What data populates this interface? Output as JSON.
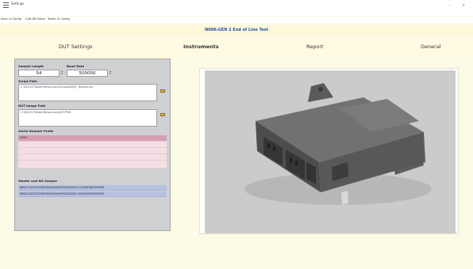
{
  "window": {
    "title": "Settings",
    "minimize_glyph": "–",
    "close_glyph": "×"
  },
  "menu": {
    "items": [
      "Save",
      "UI Config",
      "CAN DB Editor",
      "Tester IO Config"
    ]
  },
  "header": {
    "title": "N90K-GEN 2 End of Line Test"
  },
  "tabs": [
    "DUT Settings",
    "Instruments",
    "Report",
    "General"
  ],
  "dut_settings": {
    "sample_length_label": "Sample Length",
    "sample_length_value": "54",
    "baud_rate_label": "Baud Rate",
    "baud_rate_value": "500000",
    "script_path_label": "Script Path",
    "script_path_value": "C:\\DUI-EY-Tester\\Resources\\Scripts\\N90K_Testing.csv",
    "image_path_label": "DUT Image Path",
    "image_path_value": "C:\\DUI-EY-Tester\\Resources\\DUT.PNG",
    "serial_prefix_label": "Serial Number Prefix",
    "serial_prefix_values": [
      "N90K",
      "",
      "",
      "",
      ""
    ],
    "master_samples_label": "Master and NG Sample",
    "master_samples": [
      "N90K-21000123456784A3A9A9AF0203A0012-1234567892094389",
      "N90K-21000123456784A3A9A9AF0203A0012-9000000000000000"
    ]
  },
  "icons": {
    "app": "app-menu-icon",
    "script_browse": "folder-icon",
    "image_browse": "folder-icon",
    "dut_image": "electronic-module-image"
  },
  "colors": {
    "header_title": "#2f4fa8",
    "panel_bg": "#cfd0d2",
    "page_bg": "#fdfbe6",
    "serial_selected": "#d89fb3",
    "sample_row": "#b7c2e0"
  }
}
